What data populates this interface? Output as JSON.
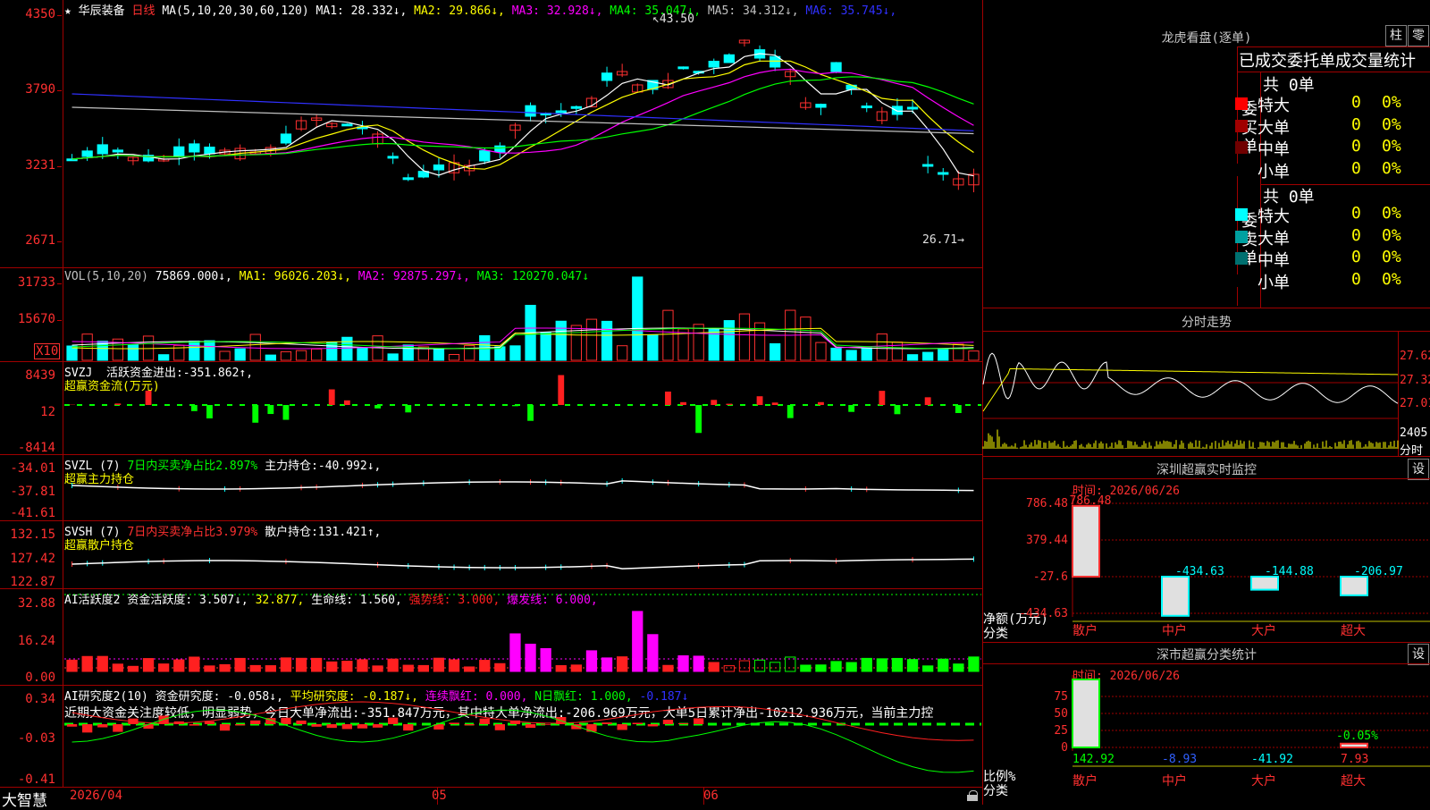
{
  "header": {
    "star": "★",
    "stock_name": "华辰装备",
    "period": "日线",
    "ma_spec": "MA(5,10,20,30,60,120)",
    "ma": [
      {
        "label": "MA1:",
        "value": "28.332",
        "arrow": "↓",
        "color": "#ffffff"
      },
      {
        "label": "MA2:",
        "value": "29.866",
        "arrow": "↓",
        "color": "#ffff00"
      },
      {
        "label": "MA3:",
        "value": "32.928",
        "arrow": "↓",
        "color": "#ff00ff"
      },
      {
        "label": "MA4:",
        "value": "35.047",
        "arrow": "↓",
        "color": "#00ff00"
      },
      {
        "label": "MA5:",
        "value": "34.312",
        "arrow": "↓",
        "color": "#c0c0c0"
      },
      {
        "label": "MA6:",
        "value": "35.745",
        "arrow": "↓",
        "color": "#3030ff"
      }
    ]
  },
  "price_axis": {
    "labels": [
      "4350",
      "3790",
      "3231",
      "2671"
    ],
    "high_marker": "43.50",
    "low_marker": "26.71"
  },
  "vol": {
    "axis": [
      "31733",
      "15670"
    ],
    "unit": "X10",
    "title": "VOL(5,10,20)",
    "value": "75869.000↓,",
    "ma": [
      {
        "t": "MA1:",
        "v": "96026.203↓,",
        "c": "#ffff00"
      },
      {
        "t": "MA2:",
        "v": "92875.297↓,",
        "c": "#ff00ff"
      },
      {
        "t": "MA3:",
        "v": "120270.047↓",
        "c": "#00ff00"
      }
    ]
  },
  "svzj": {
    "axis": [
      "8439",
      "12",
      "-8414"
    ],
    "title": "SVZJ",
    "label": "活跃资金进出:",
    "value": "-351.862↑,",
    "subtitle": "超赢资金流(万元)"
  },
  "svzl": {
    "axis": [
      "-34.01",
      "-37.81",
      "-41.61"
    ],
    "title": "SVZL (7)",
    "ratio": "7日内买卖净占比2.897%",
    "label": "主力持仓:",
    "value": "-40.992↓,",
    "subtitle": "超赢主力持仓"
  },
  "svsh": {
    "axis": [
      "132.15",
      "127.42",
      "122.87"
    ],
    "title": "SVSH (7)",
    "ratio": "7日内买卖净占比3.979%",
    "label": "散户持仓:",
    "value": "131.421↑,",
    "subtitle": "超赢散户持仓"
  },
  "ai_active": {
    "axis": [
      "32.88",
      "16.24",
      "0.00"
    ],
    "title": "AI活跃度2",
    "items": [
      {
        "t": "资金活跃度:",
        "v": "3.507↓,",
        "c": "#ffffff",
        "vc": "#ffffff"
      },
      {
        "t": "",
        "v": "32.877,",
        "c": "#ffff00",
        "vc": "#ffff00"
      },
      {
        "t": "生命线:",
        "v": "1.560,",
        "c": "#ffffff",
        "vc": "#ffffff"
      },
      {
        "t": "强势线:",
        "v": "3.000,",
        "c": "#ff2020",
        "vc": "#ff2020"
      },
      {
        "t": "爆发线:",
        "v": "6.000,",
        "c": "#ff00ff",
        "vc": "#ff00ff"
      }
    ]
  },
  "ai_research": {
    "axis": [
      "0.34",
      "-0.03",
      "-0.41"
    ],
    "title": "AI研究度2(10)",
    "items": [
      {
        "t": "资金研究度:",
        "v": "-0.058↓,",
        "c": "#ffffff"
      },
      {
        "t": "平均研究度:",
        "v": "-0.187↓,",
        "c": "#ffff00"
      },
      {
        "t": "连续飘红:",
        "v": "0.000,",
        "c": "#ff00ff"
      },
      {
        "t": "N日飘红:",
        "v": "1.000,",
        "c": "#00ff00"
      },
      {
        "t": "",
        "v": "-0.187↓",
        "c": "#3030ff"
      }
    ],
    "comment": "近期大资金关注度较低，明显弱势，今日大单净流出:-351.847万元，其中特大单净流出:-206.969万元，大单5日累计净出-10212.936万元，当前主力控"
  },
  "date_axis": {
    "start": "2026/04",
    "m5": "05",
    "m6": "06"
  },
  "brand": "大智慧",
  "dragon": {
    "title": "龙虎看盘(逐单)",
    "btn1": "柱",
    "btn2": "零",
    "stats_title": "已成交委托单成交量统计",
    "buy": {
      "side": "委买单",
      "total": "共 0单",
      "rows": [
        {
          "name": "特大",
          "qty": "0",
          "pct": "0%",
          "color": "#ff0000"
        },
        {
          "name": "大单",
          "qty": "0",
          "pct": "0%",
          "color": "#a00000"
        },
        {
          "name": "中单",
          "qty": "0",
          "pct": "0%",
          "color": "#700000"
        },
        {
          "name": "小单",
          "qty": "0",
          "pct": "0%",
          "color": "#000000"
        }
      ]
    },
    "sell": {
      "side": "委卖单",
      "total": "共 0单",
      "rows": [
        {
          "name": "特大",
          "qty": "0",
          "pct": "0%",
          "color": "#00ffff"
        },
        {
          "name": "大单",
          "qty": "0",
          "pct": "0%",
          "color": "#00a0a0"
        },
        {
          "name": "中单",
          "qty": "0",
          "pct": "0%",
          "color": "#007070"
        },
        {
          "name": "小单",
          "qty": "0",
          "pct": "0%",
          "color": "#000000"
        }
      ]
    }
  },
  "intraday": {
    "title": "分时走势",
    "axis": [
      "27.62",
      "27.32",
      "27.01"
    ],
    "vol_label": "2405",
    "vol_unit": "分时"
  },
  "sz_monitor": {
    "title": "深圳超赢实时监控",
    "btn": "设",
    "time": "时间: 2026/06/26",
    "axis": [
      "786.48",
      "379.44",
      "-27.6",
      "-434.63"
    ],
    "ylabel": "净额(万元)",
    "xlabel": "分类",
    "bars": [
      {
        "cat": "散户",
        "value": 786.48,
        "label": "786.48"
      },
      {
        "cat": "中户",
        "value": -434.63,
        "label": "-434.63"
      },
      {
        "cat": "大户",
        "value": -144.88,
        "label": "-144.88"
      },
      {
        "cat": "超大",
        "value": -206.97,
        "label": "-206.97"
      }
    ]
  },
  "sz_class": {
    "title": "深市超赢分类统计",
    "btn": "设",
    "time": "时间: 2026/06/26",
    "axis": [
      "75",
      "50",
      "25",
      "0"
    ],
    "ylabel": "比例%",
    "xlabel": "分类",
    "bars": [
      {
        "cat": "散户",
        "value": "142.92",
        "ratio": 100
      },
      {
        "cat": "中户",
        "value": "-8.93",
        "ratio": 0
      },
      {
        "cat": "大户",
        "value": "-41.92",
        "ratio": 0
      },
      {
        "cat": "超大",
        "value": "7.93",
        "ratio": 5.55,
        "pct": "-0.05%"
      }
    ]
  }
}
